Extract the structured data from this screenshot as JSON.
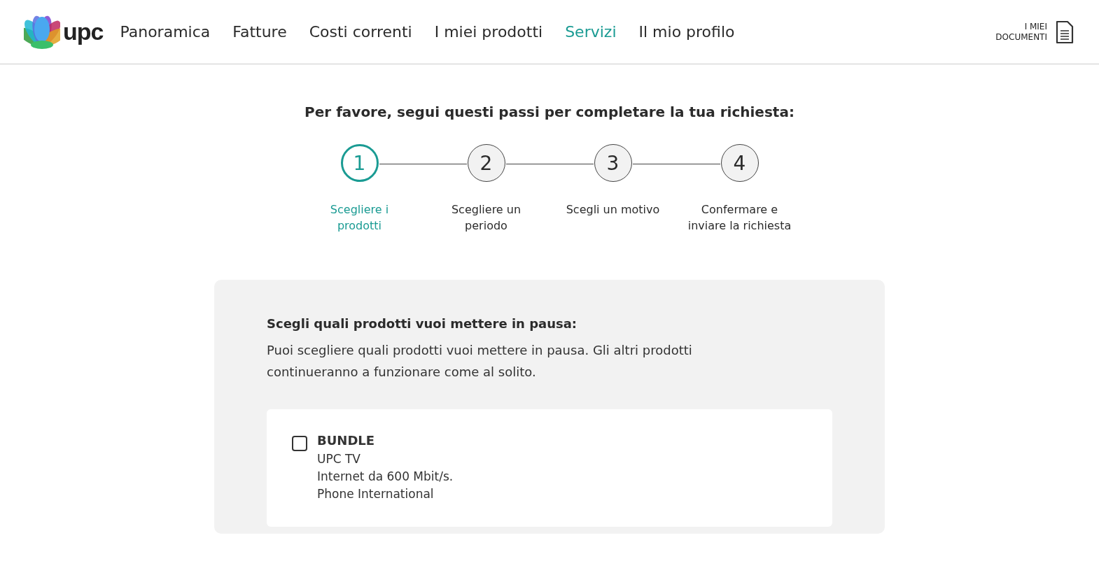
{
  "header": {
    "logo_text": "upc",
    "nav": [
      {
        "label": "Panoramica",
        "selected": false
      },
      {
        "label": "Fatture",
        "selected": false
      },
      {
        "label": "Costi correnti",
        "selected": false
      },
      {
        "label": "I miei prodotti",
        "selected": false
      },
      {
        "label": "Servizi",
        "selected": true
      },
      {
        "label": "Il mio profilo",
        "selected": false
      }
    ],
    "documents_link": [
      "I MIEI",
      "DOCUMENTI"
    ]
  },
  "title": "Per favore, segui questi passi per completare la tua richiesta:",
  "steps": [
    {
      "number": "1",
      "label": "Scegliere i prodotti",
      "selected": true
    },
    {
      "number": "2",
      "label": "Scegliere un periodo",
      "selected": false
    },
    {
      "number": "3",
      "label": "Scegli un motivo",
      "selected": false
    },
    {
      "number": "4",
      "label": "Confermare e inviare la richiesta",
      "selected": false
    }
  ],
  "panel": {
    "heading": "Scegli quali prodotti vuoi mettere in pausa:",
    "text": "Puoi scegliere quali prodotti vuoi mettere in pausa. Gli altri prodotti continueranno a funzionare come al solito.",
    "products": [
      {
        "name": "BUNDLE",
        "checked": false,
        "lines": [
          "UPC TV",
          "Internet da 600 Mbit/s.",
          "Phone International"
        ]
      }
    ]
  }
}
